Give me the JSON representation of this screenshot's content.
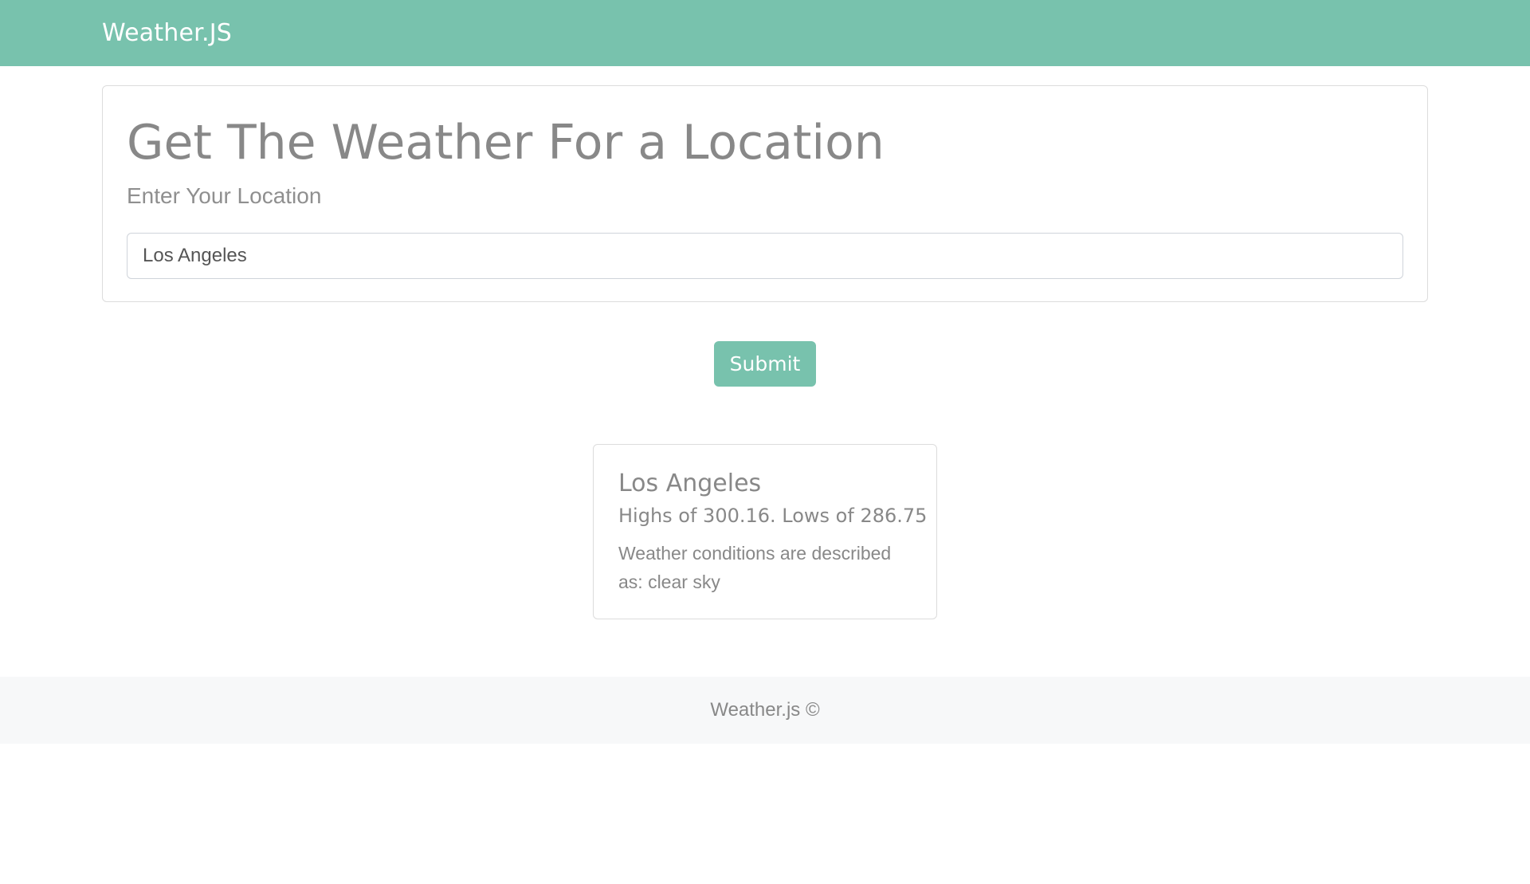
{
  "navbar": {
    "brand": "Weather.JS",
    "color": "#78c2ad"
  },
  "search": {
    "title": "Get The Weather For a Location",
    "subtitle": "Enter Your Location",
    "input_value": "Los Angeles",
    "submit_label": "Submit"
  },
  "result": {
    "city": "Los Angeles",
    "temps": "Highs of 300.16. Lows of 286.75",
    "description": "Weather conditions are described as: clear sky"
  },
  "footer": {
    "text": "Weather.js ©"
  }
}
